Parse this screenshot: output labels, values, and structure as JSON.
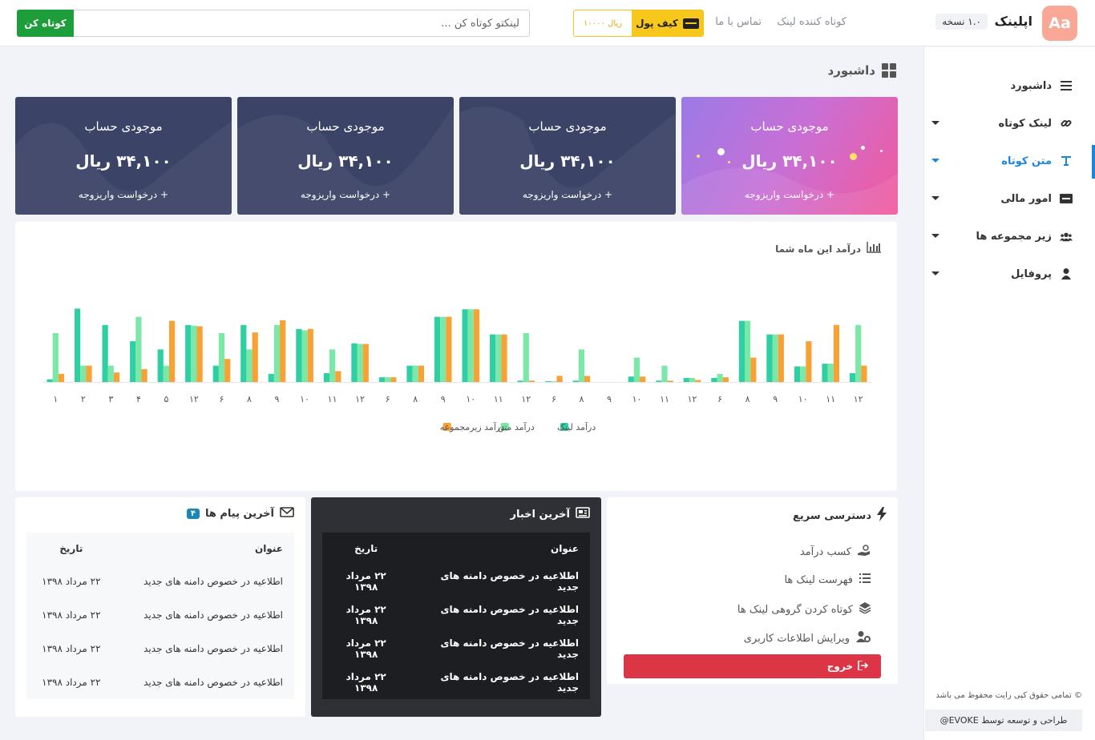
{
  "header": {
    "logo_text": "Aa",
    "brand": "اپلینک",
    "version": "۱.۰ نسخه",
    "nav": [
      "کوتاه کننده لینک",
      "تماس با ما"
    ],
    "wallet_label": "کیف پول",
    "wallet_amount": "۱۰۰۰۰ ریال",
    "search_placeholder": "لینکتو کوتاه کن ...",
    "shorten_label": "کوتاه کن"
  },
  "sidebar": {
    "items": [
      {
        "label": "داشبورد",
        "icon": "list-icon"
      },
      {
        "label": "لینک کوتاه",
        "icon": "link-icon"
      },
      {
        "label": "متن کوتاه",
        "icon": "text-icon",
        "active": true
      },
      {
        "label": "امور مالی",
        "icon": "money-icon"
      },
      {
        "label": "زیر مجموعه ها",
        "icon": "users-icon"
      },
      {
        "label": "پروفایل",
        "icon": "user-icon"
      }
    ],
    "copyright": "© تمامی حقوق کپی رایت محفوظ می باشد",
    "credit": "طراحی و توسعه توسط EVOKE@"
  },
  "page_title": "داشبورد",
  "cards": [
    {
      "title": "موجودی حساب",
      "amount": "۳۴,۱۰۰ ریال",
      "link": "+ درخواست واریزوجه"
    },
    {
      "title": "موجودی حساب",
      "amount": "۳۴,۱۰۰ ریال",
      "link": "+ درخواست واریزوجه"
    },
    {
      "title": "موجودی حساب",
      "amount": "۳۴,۱۰۰ ریال",
      "link": "+ درخواست واریزوجه"
    },
    {
      "title": "موجودی حساب",
      "amount": "۳۴,۱۰۰ ریال",
      "link": "+ درخواست واریزوجه"
    }
  ],
  "colors": {
    "accent": "#1a86e0",
    "link_series": "#2ecfa3",
    "text_series": "#7be8a8",
    "sub_series": "#f8a134",
    "logout": "#dc3545",
    "shorten": "#1e9e3a",
    "wallet": "#f7c71c"
  },
  "chart_data": {
    "type": "bar",
    "title": "درآمد این ماه شما",
    "categories": [
      "۱",
      "۲",
      "۳",
      "۴",
      "۵",
      "۱۲",
      "۶",
      "۸",
      "۹",
      "۱۰",
      "۱۱",
      "۱۲",
      "۶",
      "۸",
      "۹",
      "۱۰",
      "۱۱",
      "۱۲",
      "۶",
      "۸",
      "۹",
      "۱۰",
      "۱۱",
      "۱۲",
      "۶",
      "۸",
      "۹",
      "۱۰",
      "۱۱",
      "۱۲"
    ],
    "series": [
      {
        "name": "درآمد لینک",
        "color": "#2ecfa3",
        "values": [
          4,
          108,
          84,
          60,
          48,
          84,
          24,
          84,
          12,
          78,
          13,
          57,
          7,
          24,
          96,
          107,
          70,
          2,
          1,
          2,
          0,
          8,
          2,
          6,
          6,
          90,
          70,
          23,
          27,
          13
        ]
      },
      {
        "name": "درآمد متن",
        "color": "#7be8a8",
        "values": [
          72,
          24,
          24,
          96,
          24,
          83,
          72,
          48,
          84,
          76,
          48,
          56,
          7,
          24,
          96,
          107,
          70,
          72,
          1,
          48,
          0,
          36,
          24,
          6,
          12,
          90,
          70,
          23,
          27,
          84
        ]
      },
      {
        "name": "درآمد زیرمجموعه",
        "color": "#f8a134",
        "values": [
          12,
          24,
          14,
          19,
          90,
          82,
          34,
          73,
          91,
          78,
          16,
          56,
          7,
          24,
          96,
          107,
          70,
          2,
          9,
          9,
          0,
          8,
          2,
          3,
          7,
          36,
          70,
          60,
          84,
          24
        ]
      }
    ],
    "ylim": [
      0,
      112
    ],
    "legend": "bottom-center",
    "grid": false
  },
  "messages": {
    "title": "آخرین پیام ها",
    "count": "۴",
    "col_title": "عنوان",
    "col_date": "تاریخ",
    "rows": [
      {
        "title": "اطلاعیه در خصوص دامنه های جدید",
        "date": "۲۲ مرداد ۱۳۹۸"
      },
      {
        "title": "اطلاعیه در خصوص دامنه های جدید",
        "date": "۲۲ مرداد ۱۳۹۸"
      },
      {
        "title": "اطلاعیه در خصوص دامنه های جدید",
        "date": "۲۲ مرداد ۱۳۹۸"
      },
      {
        "title": "اطلاعیه در خصوص دامنه های جدید",
        "date": "۲۲ مرداد ۱۳۹۸"
      }
    ]
  },
  "news": {
    "title": "آخرین اخبار",
    "col_title": "عنوان",
    "col_date": "تاریخ",
    "rows": [
      {
        "title": "اطلاعیه در خصوص دامنه های جدید",
        "date": "۲۲ مرداد ۱۳۹۸"
      },
      {
        "title": "اطلاعیه در خصوص دامنه های جدید",
        "date": "۲۲ مرداد ۱۳۹۸"
      },
      {
        "title": "اطلاعیه در خصوص دامنه های جدید",
        "date": "۲۲ مرداد ۱۳۹۸"
      },
      {
        "title": "اطلاعیه در خصوص دامنه های جدید",
        "date": "۲۲ مرداد ۱۳۹۸"
      }
    ]
  },
  "quick": {
    "title": "دسترسی سریع",
    "items": [
      {
        "label": "کسب درآمد",
        "icon": "hand-coin-icon"
      },
      {
        "label": "فهرست لینک ها",
        "icon": "list-icon"
      },
      {
        "label": "کوتاه کردن گروهی لینک ها",
        "icon": "layers-icon"
      },
      {
        "label": "ویرایش اطلاعات کاربری",
        "icon": "user-cog-icon"
      }
    ],
    "logout": "خروج"
  }
}
